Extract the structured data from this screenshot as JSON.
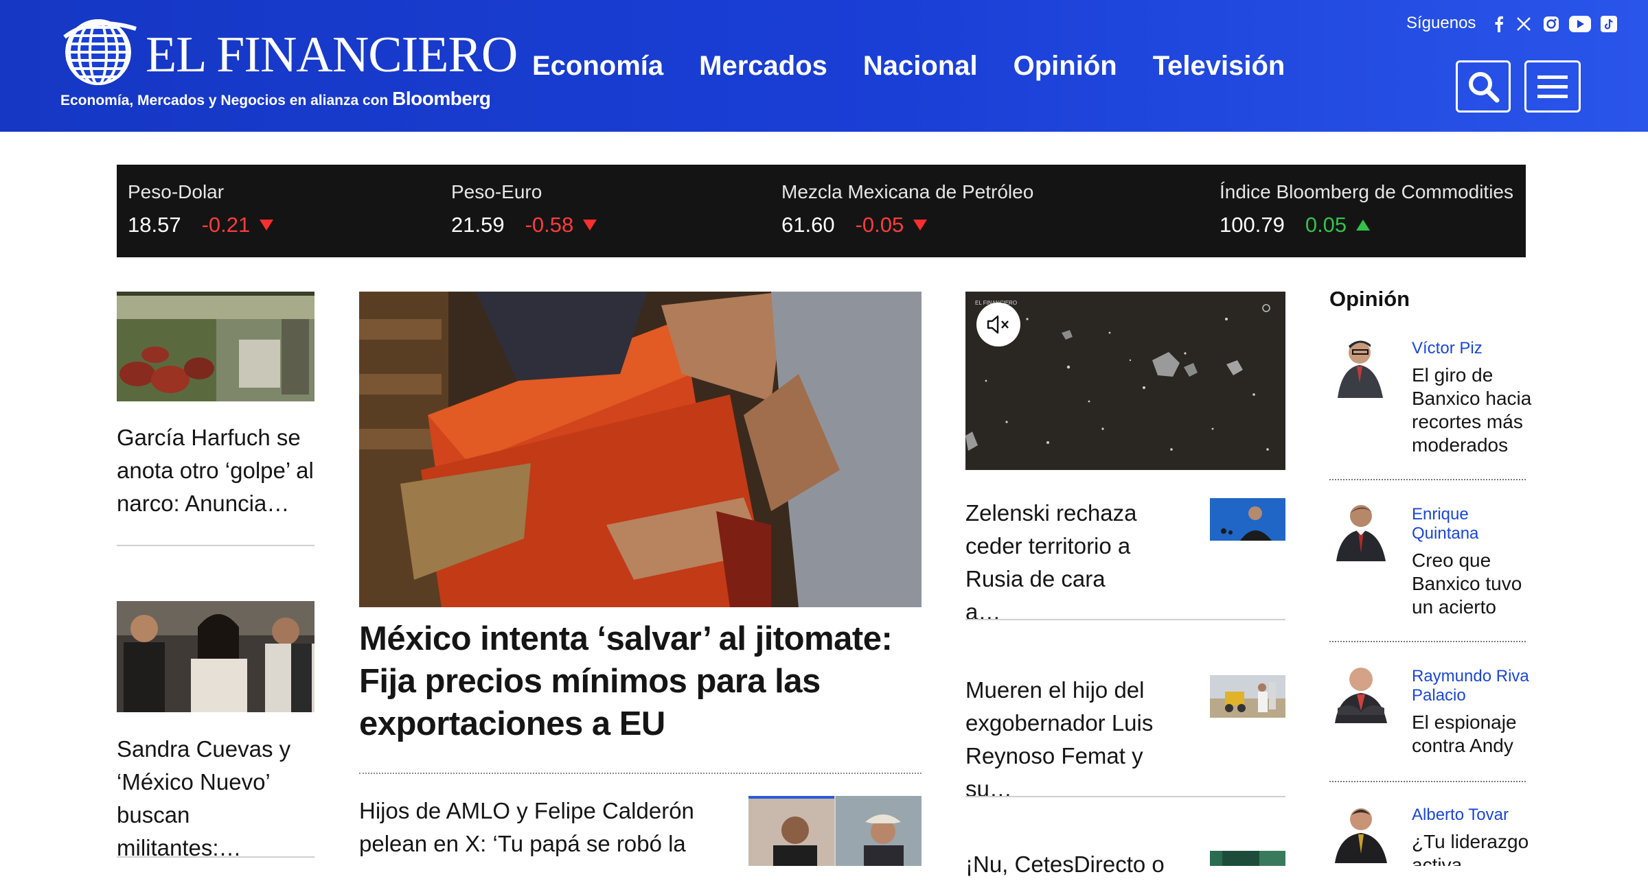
{
  "header": {
    "logo_text": "EL FINANCIERO",
    "tagline": "Economía, Mercados y Negocios en alianza con",
    "tagline_brand": "Bloomberg",
    "nav": [
      "Economía",
      "Mercados",
      "Nacional",
      "Opinión",
      "Televisión"
    ],
    "follow_label": "Síguenos",
    "social_icons": [
      "facebook-icon",
      "x-icon",
      "instagram-icon",
      "youtube-icon",
      "tiktok-icon"
    ],
    "search_icon": "search-icon",
    "menu_icon": "hamburger-menu-icon",
    "brand_color": "#1a3fd6"
  },
  "ticker": [
    {
      "label": "Peso-Dolar",
      "value": "18.57",
      "change": "-0.21",
      "direction": "down"
    },
    {
      "label": "Peso-Euro",
      "value": "21.59",
      "change": "-0.58",
      "direction": "down"
    },
    {
      "label": "Mezcla Mexicana de Petróleo",
      "value": "61.60",
      "change": "-0.05",
      "direction": "down"
    },
    {
      "label": "Índice Bloomberg de Commodities",
      "value": "100.79",
      "change": "0.05",
      "direction": "up"
    }
  ],
  "left_column": [
    {
      "headline": "García Harfuch se anota otro ‘golpe’ al narco: Anuncia…"
    },
    {
      "headline": "Sandra Cuevas y ‘México Nuevo’ buscan militantes:…"
    }
  ],
  "main": {
    "headline": "México intenta ‘salvar’ al jitomate: Fija precios mínimos para las exportaciones a EU",
    "secondary_headline": "Hijos de AMLO y Felipe Calderón pelean en X: ‘Tu papá se robó la"
  },
  "video": {
    "mute_icon": "mute-icon",
    "bug_text": "EL FINANCIERO"
  },
  "right_column": [
    {
      "headline": "Zelenski rechaza ceder territorio a Rusia de cara a…"
    },
    {
      "headline": "Mueren el hijo del exgobernador Luis Reynoso Femat y su…"
    },
    {
      "headline": "¡Nu, CetesDirecto o"
    }
  ],
  "opinion": {
    "title": "Opinión",
    "items": [
      {
        "author": "Víctor Piz",
        "headline": "El giro de Banxico hacia recortes más moderados"
      },
      {
        "author": "Enrique Quintana",
        "headline": "Creo que Banxico tuvo un acierto"
      },
      {
        "author": "Raymundo Riva Palacio",
        "headline": "El espionaje contra Andy"
      },
      {
        "author": "Alberto Tovar",
        "headline": "¿Tu liderazgo activa"
      }
    ]
  }
}
